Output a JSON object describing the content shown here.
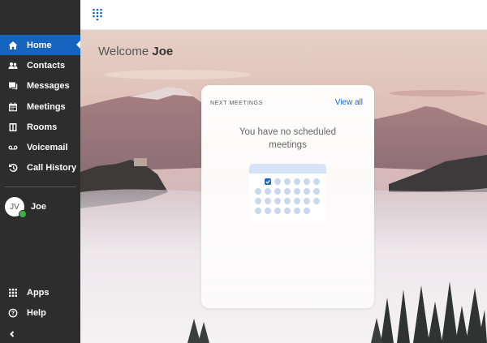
{
  "sidebar": {
    "items": [
      {
        "label": "Home",
        "icon": "home-icon",
        "active": true
      },
      {
        "label": "Contacts",
        "icon": "contacts-icon"
      },
      {
        "label": "Messages",
        "icon": "messages-icon"
      },
      {
        "label": "Meetings",
        "icon": "meetings-icon"
      },
      {
        "label": "Rooms",
        "icon": "rooms-icon"
      },
      {
        "label": "Voicemail",
        "icon": "voicemail-icon"
      },
      {
        "label": "Call History",
        "icon": "call-history-icon"
      }
    ],
    "user": {
      "initials": "JV",
      "name": "Joe",
      "presence_color": "#3cb043"
    },
    "bottom_items": [
      {
        "label": "Apps",
        "icon": "apps-icon"
      },
      {
        "label": "Help",
        "icon": "help-icon"
      }
    ]
  },
  "colors": {
    "accent": "#1565c0",
    "sidebar_bg": "#2d2d2d"
  },
  "main": {
    "welcome_prefix": "Welcome",
    "welcome_name": "Joe",
    "card": {
      "label": "NEXT MEETINGS",
      "link": "View all",
      "empty_text": "You have no scheduled meetings"
    }
  }
}
